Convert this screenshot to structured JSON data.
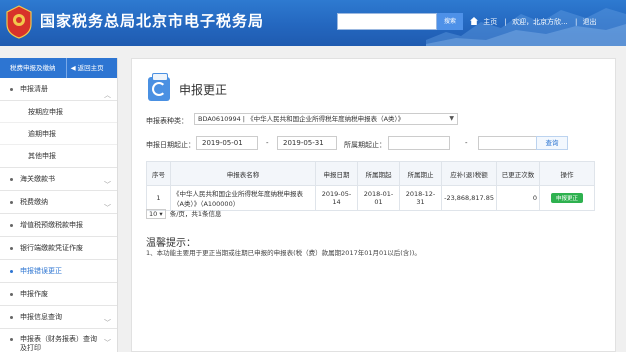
{
  "header": {
    "title": "国家税务总局北京市电子税务局",
    "logo_text": "中国税务",
    "search": {
      "placeholder": "",
      "button": "搜索"
    },
    "links": {
      "home": "主页",
      "welcome": "欢迎，北京方欣... ",
      "logout": "退出"
    }
  },
  "sidebar": {
    "head": {
      "label": "税费申报及缴纳",
      "back": "返回主页"
    },
    "items": [
      {
        "label": "申报清册",
        "expandable": true
      },
      {
        "label": "按期应申报",
        "sub": true
      },
      {
        "label": "逾期申报",
        "sub": true
      },
      {
        "label": "其他申报",
        "sub": true
      },
      {
        "label": "海关缴款书",
        "expandable": true
      },
      {
        "label": "税费缴纳",
        "expandable": true
      },
      {
        "label": "增值税预缴税款申报"
      },
      {
        "label": "银行端缴款凭证作废"
      },
      {
        "label": "申报错误更正",
        "active": true
      },
      {
        "label": "申报作废"
      },
      {
        "label": "申报信息查询",
        "expandable": true
      },
      {
        "label": "申报表（财务报表）查询",
        "label2": "及打印",
        "expandable": true
      }
    ]
  },
  "main": {
    "title": "申报更正",
    "filters": {
      "type_label": "申报表种类：",
      "type_value": "BDA0610994 | 《中华人民共和国企业所得税年度纳税申报表（A类）》",
      "date_label": "申报日期起止：",
      "date_from": "2019-05-01",
      "date_to": "2019-05-31",
      "period_label": "所属期起止：",
      "period_from": "",
      "period_to": "",
      "dash": "-",
      "query_button": "查询"
    },
    "table": {
      "headers": [
        "序号",
        "申报表名称",
        "申报日期",
        "所属期起",
        "所属期止",
        "应补(退)税额",
        "已更正次数",
        "操作"
      ],
      "rows": [
        {
          "index": "1",
          "name": "《中华人民共和国企业所得税年度纳税申报表（A类）》（A100000）",
          "declare_date": "2019-05-14",
          "period_from": "2018-01-01",
          "period_to": "2018-12-31",
          "amount": "-23,868,817.85",
          "corrections": "0",
          "action": "申报更正"
        }
      ]
    },
    "pager": {
      "page_size": "10",
      "text": "条/页，共1条信息"
    },
    "tips": {
      "title": "温馨提示：",
      "text": "1、本功能主要用于更正当期或往期已申报的申报表(税（费）款属期2017年01月01以后(含))。"
    }
  }
}
